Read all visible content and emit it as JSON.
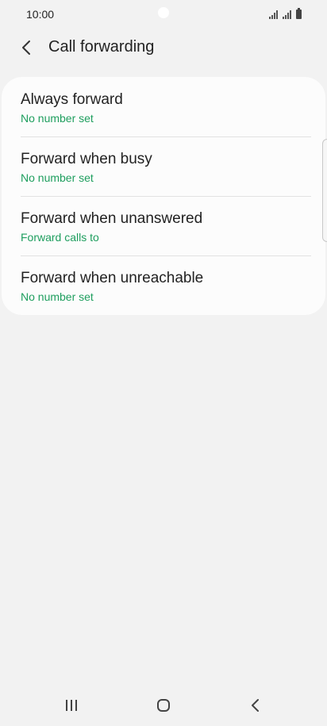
{
  "status_bar": {
    "time": "10:00"
  },
  "header": {
    "title": "Call forwarding",
    "back_icon": "chevron-left-icon"
  },
  "forwarding_options": [
    {
      "title": "Always forward",
      "subtitle": "No number set"
    },
    {
      "title": "Forward when busy",
      "subtitle": "No number set"
    },
    {
      "title": "Forward when unanswered",
      "subtitle": "Forward calls to"
    },
    {
      "title": "Forward when unreachable",
      "subtitle": "No number set"
    }
  ],
  "navigation_bar": {
    "recents_icon": "recent-apps-icon",
    "home_icon": "home-icon",
    "back_icon": "back-icon"
  },
  "colors": {
    "background": "#f2f2f2",
    "card": "#fcfcfc",
    "accent": "#1e9e5e",
    "text": "#222222"
  }
}
